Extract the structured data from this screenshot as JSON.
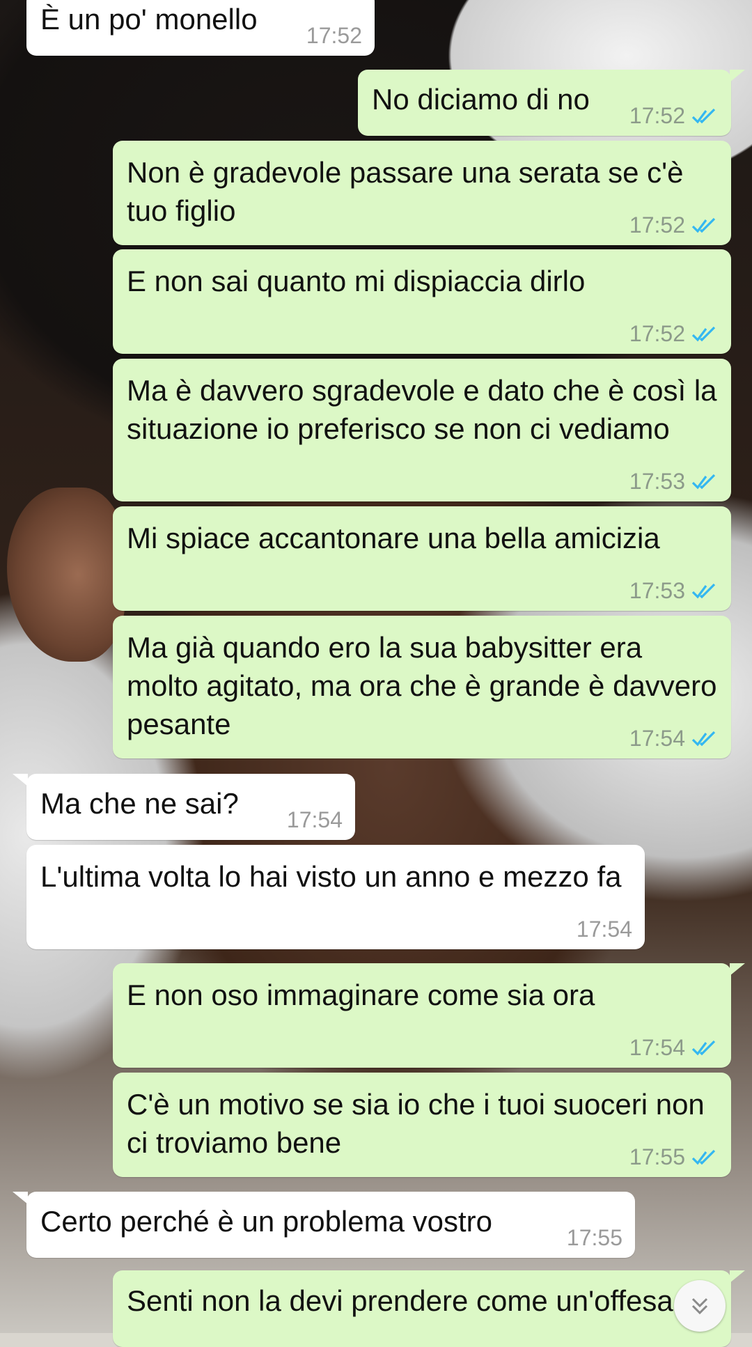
{
  "messages": [
    {
      "dir": "in",
      "text": "È un po' monello",
      "time": "17:52"
    },
    {
      "dir": "out",
      "text": "No diciamo di no",
      "time": "17:52"
    },
    {
      "dir": "out",
      "text": "Non è gradevole passare una serata se c'è tuo figlio",
      "time": "17:52"
    },
    {
      "dir": "out",
      "text": "E non sai quanto mi dispiaccia dirlo",
      "time": "17:52"
    },
    {
      "dir": "out",
      "text": "Ma è davvero sgradevole e dato che è così la situazione io preferisco se non ci vediamo",
      "time": "17:53"
    },
    {
      "dir": "out",
      "text": "Mi spiace accantonare una bella amicizia",
      "time": "17:53"
    },
    {
      "dir": "out",
      "text": "Ma già quando ero la sua babysitter era molto agitato, ma ora che è grande è davvero pesante",
      "time": "17:54"
    },
    {
      "dir": "in",
      "text": "Ma che ne sai?",
      "time": "17:54"
    },
    {
      "dir": "in",
      "text": "L'ultima volta lo hai visto un anno e mezzo fa",
      "time": "17:54"
    },
    {
      "dir": "out",
      "text": "E non oso immaginare come sia ora",
      "time": "17:54"
    },
    {
      "dir": "out",
      "text": "C'è un motivo se sia io che i tuoi suoceri non ci troviamo bene",
      "time": "17:55"
    },
    {
      "dir": "in",
      "text": "Certo perché è un problema vostro",
      "time": "17:55"
    },
    {
      "dir": "out",
      "text": "Senti non la devi prendere come un'offesa",
      "time": ""
    }
  ],
  "colors": {
    "incoming": "#ffffff",
    "outgoing": "#dcf8c6",
    "read_ticks": "#34b7f1"
  },
  "icons": {
    "read_receipt": "double-check-icon",
    "scroll_down": "chevron-double-down-icon"
  }
}
